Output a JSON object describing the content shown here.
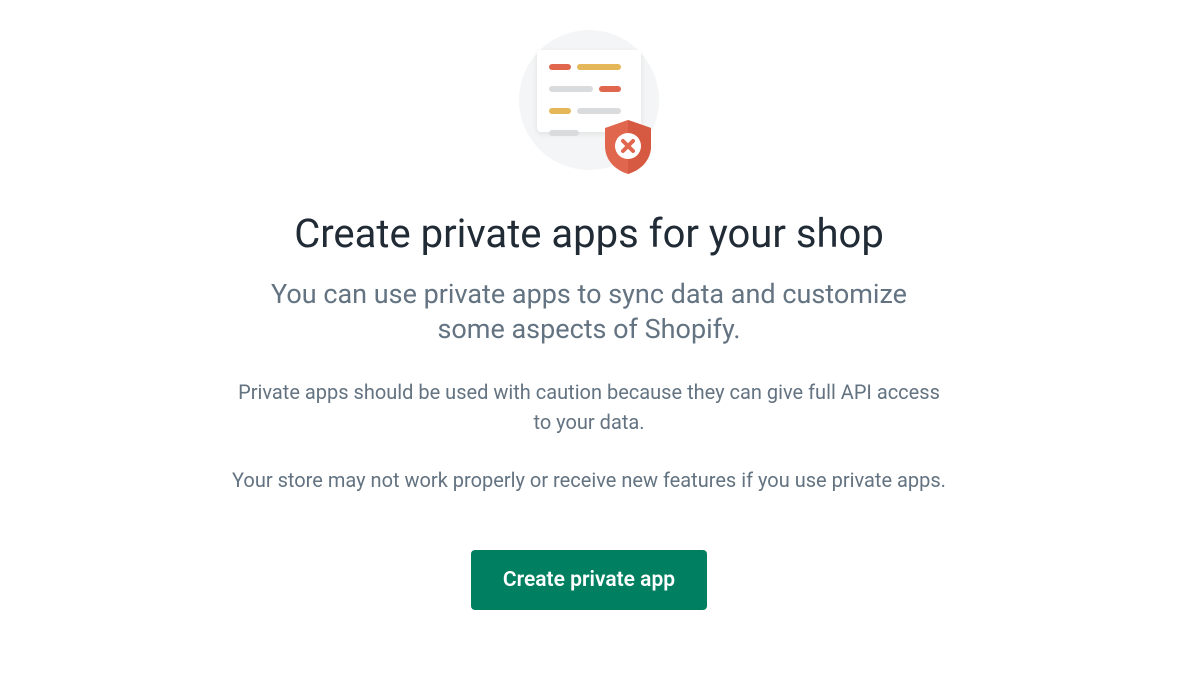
{
  "heading": "Create private apps for your shop",
  "subheading": "You can use private apps to sync data and customize some aspects of Shopify.",
  "body1": "Private apps should be used with caution because they can give full API access to your data.",
  "body2": "Your store may not work properly or receive new features if you use private apps.",
  "button_label": "Create private app",
  "colors": {
    "primary": "#008060",
    "text_dark": "#212b36",
    "text_subdued": "#637381"
  }
}
